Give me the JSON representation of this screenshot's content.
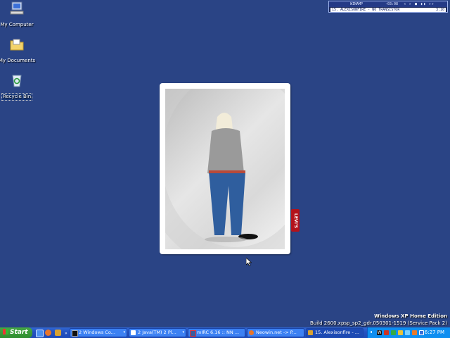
{
  "desktop": {
    "icons": [
      {
        "label": "My Computer",
        "icon": "computer-icon"
      },
      {
        "label": "My Documents",
        "icon": "folder-icon"
      },
      {
        "label": "Recycle Bin",
        "icon": "recycle-bin-icon"
      }
    ],
    "background_color": "#2a4485"
  },
  "winamp": {
    "logo": "WINAMP",
    "time": "-03:08",
    "track": "15. ALEXISONFIRE - NO TRANSISTOR",
    "duration": "3:10"
  },
  "wallpaper_badge": "LEVI'S",
  "edition": {
    "title": "Windows XP Home Edition",
    "build": "Build 2600.xpsp_sp2_gdr.050301-1519 (Service Pack 2)"
  },
  "taskbar": {
    "start_label": "Start",
    "quick_launch": [
      "ie-icon",
      "firefox-icon",
      "winamp-icon"
    ],
    "tasks": [
      {
        "label": "2 Windows Co...",
        "icon": "cmd-icon"
      },
      {
        "label": "2 Java(TM) 2 Pl...",
        "icon": "java-icon"
      },
      {
        "label": "mIRC 6.16 :: NN ...",
        "icon": "mirc-icon"
      },
      {
        "label": "Neowin.net -> P...",
        "icon": "firefox-icon"
      },
      {
        "label": "15. Alexisonfire - ...",
        "icon": "winamp-icon"
      }
    ],
    "clock": "6:27 PM"
  },
  "colors": {
    "taskbar": "#2453c2",
    "start": "#3c9b3c",
    "tray": "#0f8ef0"
  }
}
